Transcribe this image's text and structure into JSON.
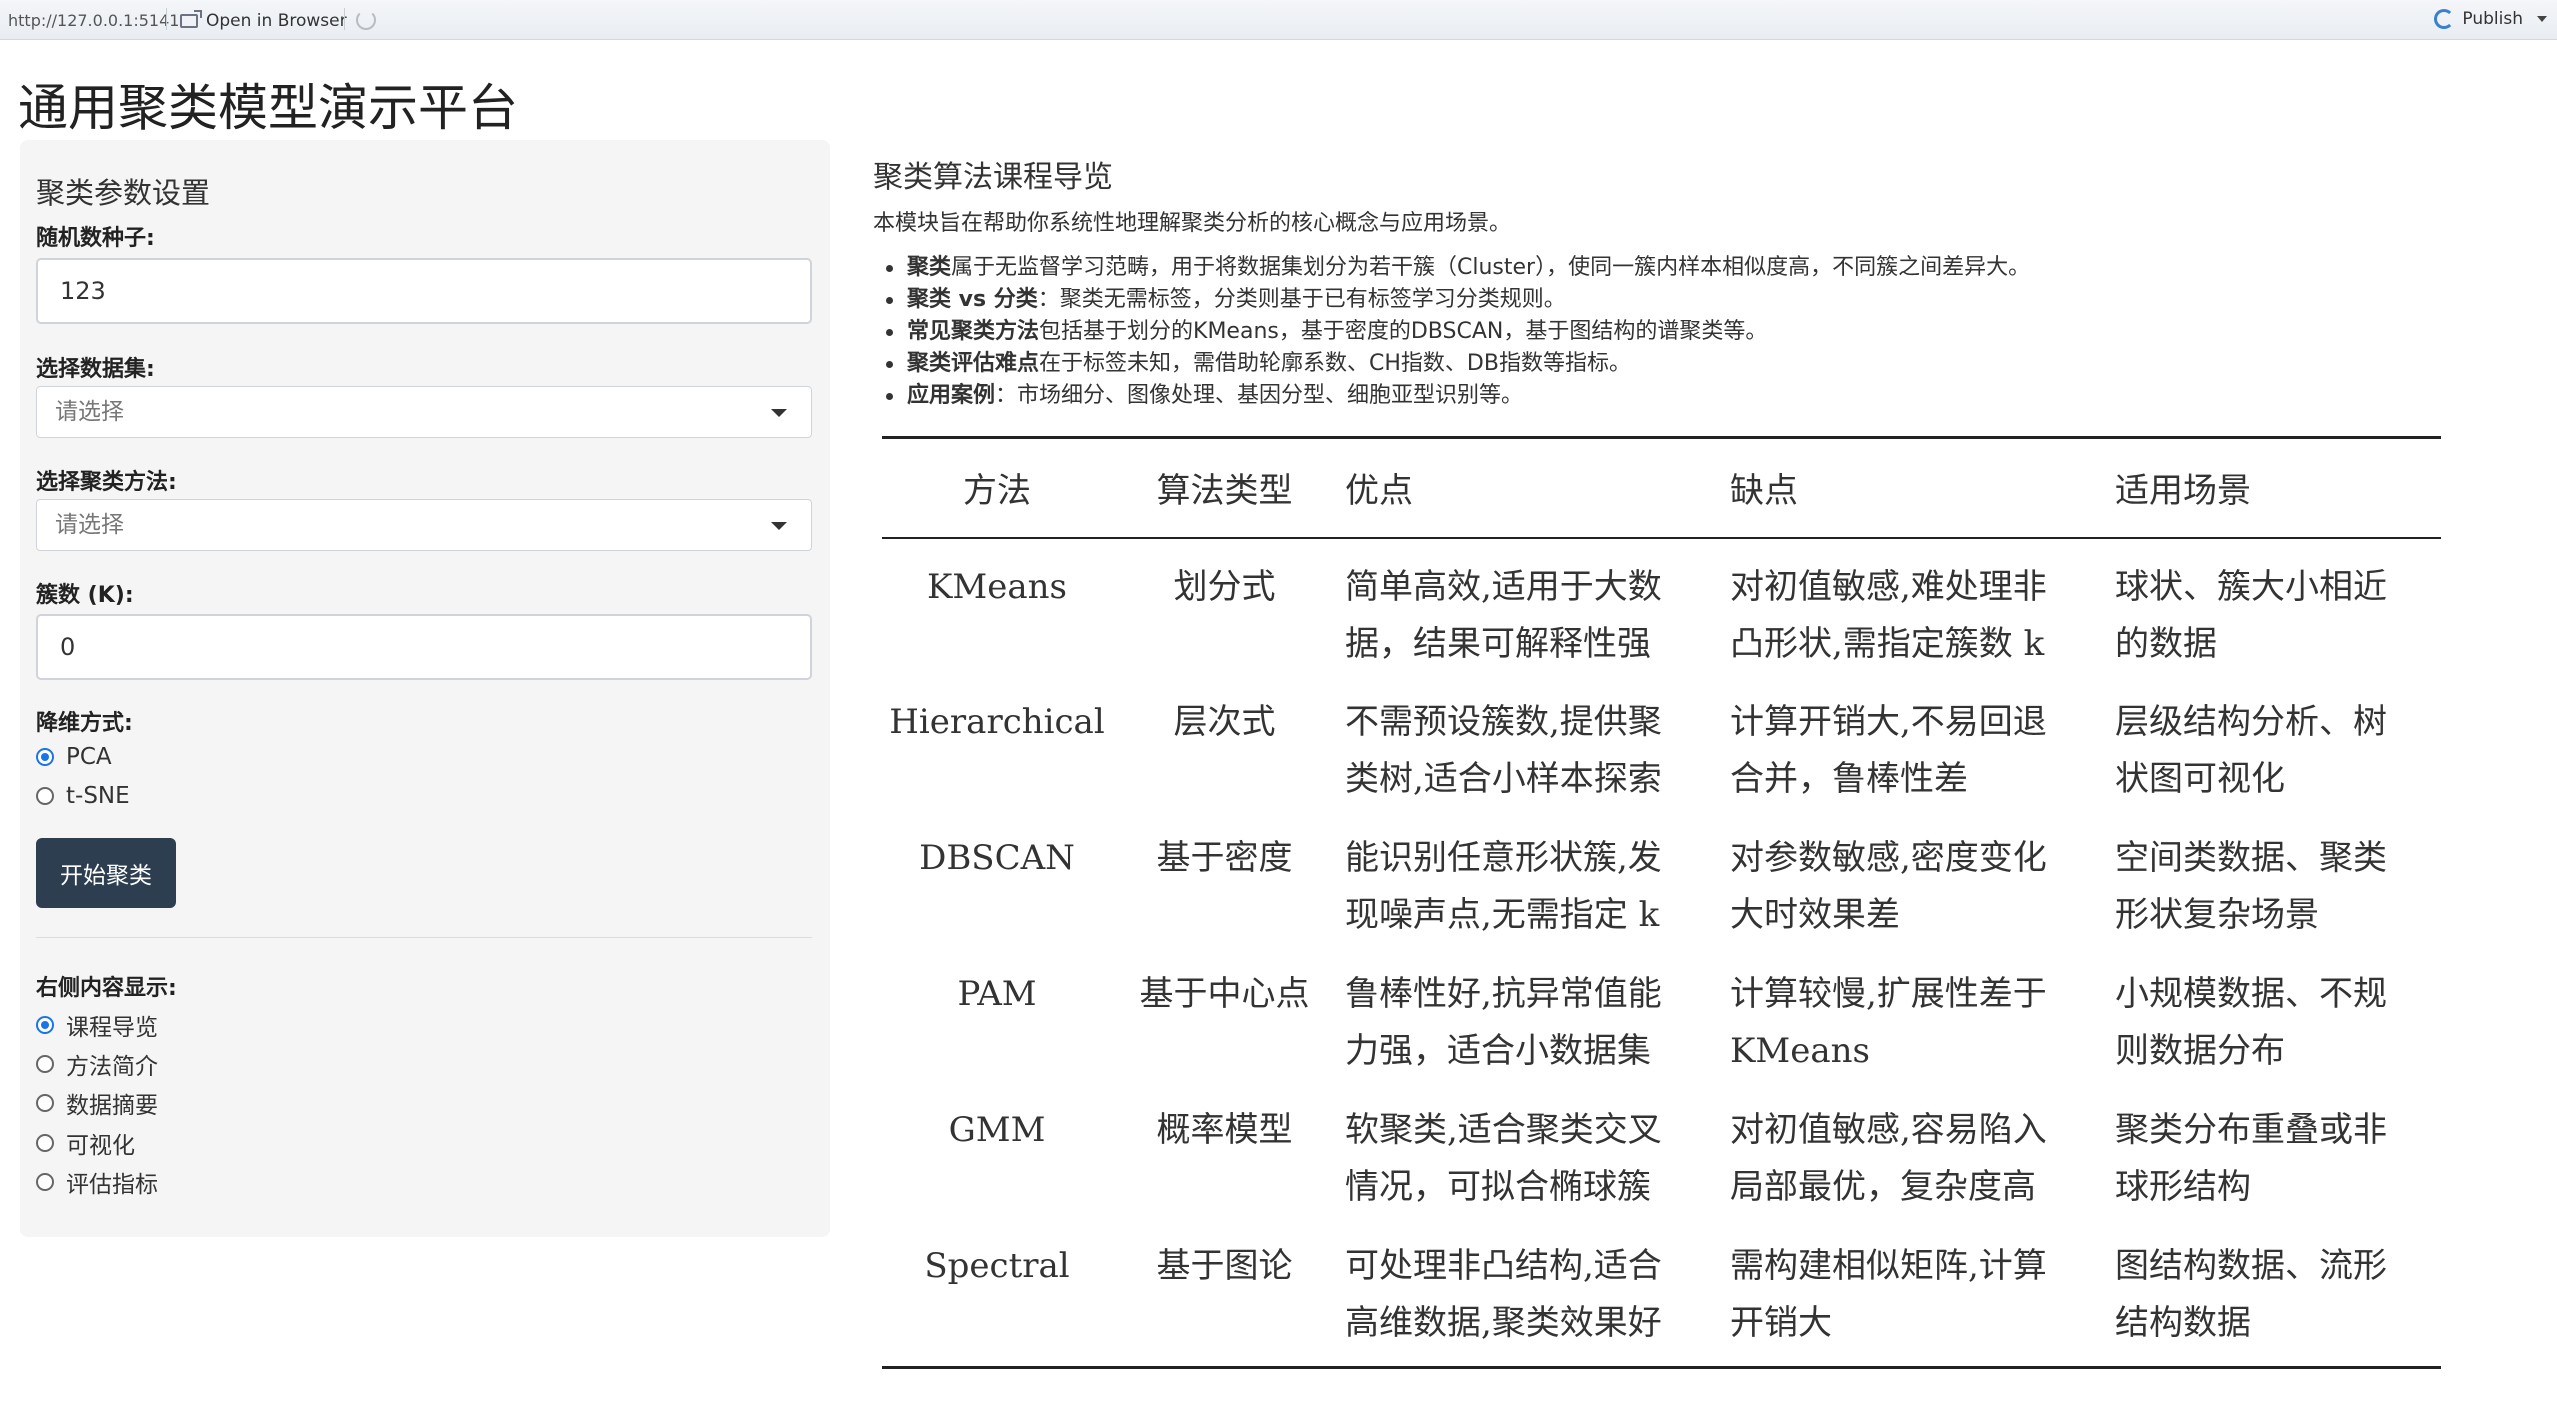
{
  "toolbar": {
    "url": "http://127.0.0.1:5141",
    "open_in_browser": "Open in Browser",
    "publish": "Publish"
  },
  "app_title": "通用聚类模型演示平台",
  "sidebar": {
    "heading": "聚类参数设置",
    "seed_label": "随机数种子:",
    "seed_value": "123",
    "dataset_label": "选择数据集:",
    "dataset_placeholder": "请选择",
    "method_label": "选择聚类方法:",
    "method_placeholder": "请选择",
    "k_label": "簇数 (K):",
    "k_value": "0",
    "reduction_label": "降维方式:",
    "reduction_options": [
      "PCA",
      "t-SNE"
    ],
    "reduction_selected": "PCA",
    "start_button": "开始聚类",
    "display_label": "右侧内容显示:",
    "display_options": [
      "课程导览",
      "方法简介",
      "数据摘要",
      "可视化",
      "评估指标"
    ],
    "display_selected": "课程导览"
  },
  "main": {
    "heading": "聚类算法课程导览",
    "intro": "本模块旨在帮助你系统性地理解聚类分析的核心概念与应用场景。",
    "bullets": [
      {
        "bold": "聚类",
        "text": "属于无监督学习范畴，用于将数据集划分为若干簇（Cluster），使同一簇内样本相似度高，不同簇之间差异大。"
      },
      {
        "bold": "聚类 vs 分类",
        "text": "：聚类无需标签，分类则基于已有标签学习分类规则。"
      },
      {
        "bold": "常见聚类方法",
        "text": "包括基于划分的KMeans，基于密度的DBSCAN，基于图结构的谱聚类等。"
      },
      {
        "bold": "聚类评估难点",
        "text": "在于标签未知，需借助轮廓系数、CH指数、DB指数等指标。"
      },
      {
        "bold": "应用案例",
        "text": "：市场细分、图像处理、基因分型、细胞亚型识别等。"
      }
    ],
    "table": {
      "headers": [
        "方法",
        "算法类型",
        "优点",
        "缺点",
        "适用场景"
      ],
      "rows": [
        [
          "KMeans",
          "划分式",
          "简单高效,适用于大数\n据，结果可解释性强",
          "对初值敏感,难处理非\n凸形状,需指定簇数 k",
          "球状、簇大小相近\n的数据"
        ],
        [
          "Hierarchical",
          "层次式",
          "不需预设簇数,提供聚\n类树,适合小样本探索",
          "计算开销大,不易回退\n合并，鲁棒性差",
          "层级结构分析、树\n状图可视化"
        ],
        [
          "DBSCAN",
          "基于密度",
          "能识别任意形状簇,发\n现噪声点,无需指定 k",
          "对参数敏感,密度变化\n大时效果差",
          "空间类数据、聚类\n形状复杂场景"
        ],
        [
          "PAM",
          "基于中心点",
          "鲁棒性好,抗异常值能\n力强，适合小数据集",
          "计算较慢,扩展性差于\nKMeans",
          "小规模数据、不规\n则数据分布"
        ],
        [
          "GMM",
          "概率模型",
          "软聚类,适合聚类交叉\n情况，可拟合椭球簇",
          "对初值敏感,容易陷入\n局部最优，复杂度高",
          "聚类分布重叠或非\n球形结构"
        ],
        [
          "Spectral",
          "基于图论",
          "可处理非凸结构,适合\n高维数据,聚类效果好",
          "需构建相似矩阵,计算\n开销大",
          "图结构数据、流形\n结构数据"
        ]
      ]
    }
  }
}
